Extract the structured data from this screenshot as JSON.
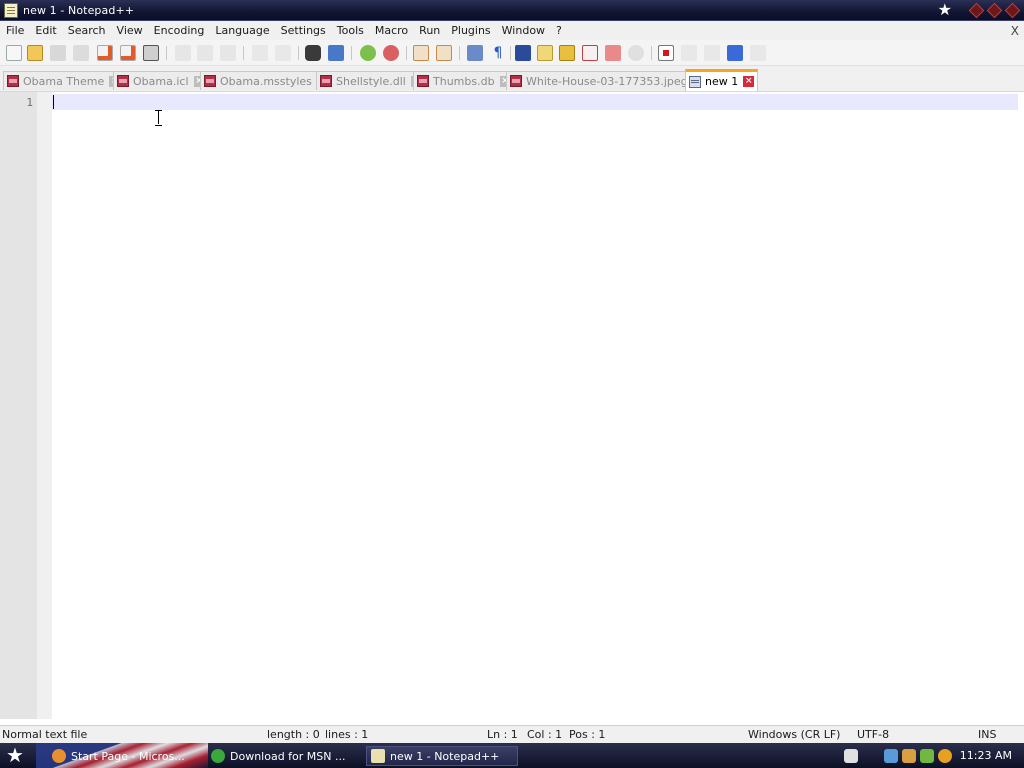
{
  "window": {
    "title": "new 1 - Notepad++"
  },
  "menu": [
    "File",
    "Edit",
    "Search",
    "View",
    "Encoding",
    "Language",
    "Settings",
    "Tools",
    "Macro",
    "Run",
    "Plugins",
    "Window",
    "?"
  ],
  "menu_close": "X",
  "toolbar_icons": [
    "new-file-icon",
    "open-file-icon",
    "save-icon",
    "save-all-icon",
    "close-icon",
    "close-all-icon",
    "print-icon",
    "cut-icon",
    "copy-icon",
    "paste-icon",
    "undo-icon",
    "redo-icon",
    "find-icon",
    "replace-icon",
    "zoom-in-icon",
    "zoom-out-icon",
    "sync-vertical-icon",
    "sync-horizontal-icon",
    "word-wrap-icon",
    "show-all-chars-icon",
    "indent-guide-icon",
    "doc-map-icon",
    "function-list-icon",
    "folder-workspace-icon",
    "monitor-icon",
    "record-macro-icon",
    "stop-record-icon",
    "play-macro-icon",
    "run-macro-multiple-icon",
    "save-macro-icon"
  ],
  "tabs": [
    {
      "label": "Obama Theme",
      "active": false
    },
    {
      "label": "Obama.icl",
      "active": false
    },
    {
      "label": "Obama.msstyles",
      "active": false
    },
    {
      "label": "Shellstyle.dll",
      "active": false
    },
    {
      "label": "Thumbs.db",
      "active": false
    },
    {
      "label": "White-House-03-177353.jpeg",
      "active": false
    },
    {
      "label": "new 1",
      "active": true
    }
  ],
  "editor": {
    "line_number": "1",
    "content": ""
  },
  "status": {
    "file_type": "Normal text file",
    "length": "length : 0",
    "lines": "lines : 1",
    "ln": "Ln : 1",
    "col": "Col : 1",
    "pos": "Pos : 1",
    "eol": "Windows (CR LF)",
    "encoding": "UTF-8",
    "mode": "INS"
  },
  "taskbar": {
    "tasks": [
      {
        "label": "Start Page - Micros...",
        "active": false
      },
      {
        "label": "Download for MSN ...",
        "active": false
      },
      {
        "label": "new 1 - Notepad++",
        "active": true
      }
    ],
    "clock": "11:23 AM"
  },
  "colors": {
    "active_tab_accent": "#f5a623",
    "current_line": "#e8e8ff",
    "taskbar": "#1a1c38"
  }
}
